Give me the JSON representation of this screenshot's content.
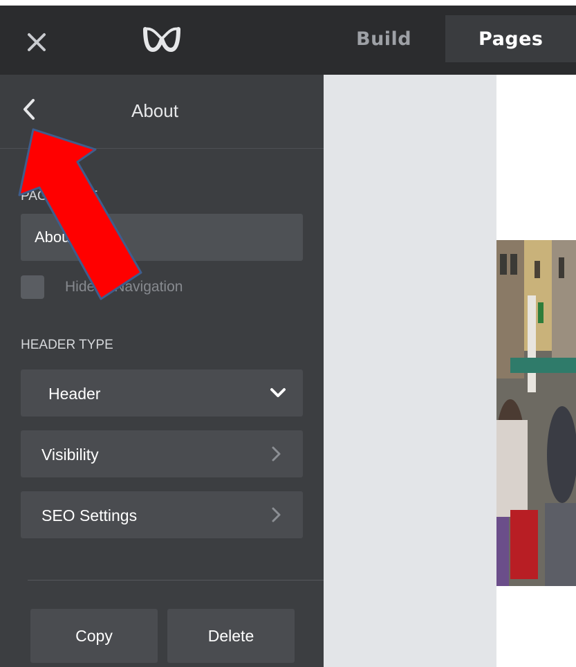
{
  "topbar": {
    "close_icon": "close-icon",
    "logo_icon": "weebly-logo-icon",
    "tabs": [
      {
        "label": "Build",
        "active": false
      },
      {
        "label": "Pages",
        "active": true
      }
    ]
  },
  "sidebar": {
    "title": "About",
    "back_icon": "chevron-left-icon",
    "page_name_label": "PAGE NAME",
    "page_name_value": "About",
    "hide_nav_label": "Hide in Navigation",
    "header_type_label": "HEADER TYPE",
    "header_type_value": "Header",
    "visibility_label": "Visibility",
    "seo_label": "SEO Settings",
    "copy_label": "Copy",
    "delete_label": "Delete"
  },
  "colors": {
    "topbar": "#2b2c2e",
    "sidebar": "#3c3e41",
    "annotation_arrow": "#ff0000"
  }
}
